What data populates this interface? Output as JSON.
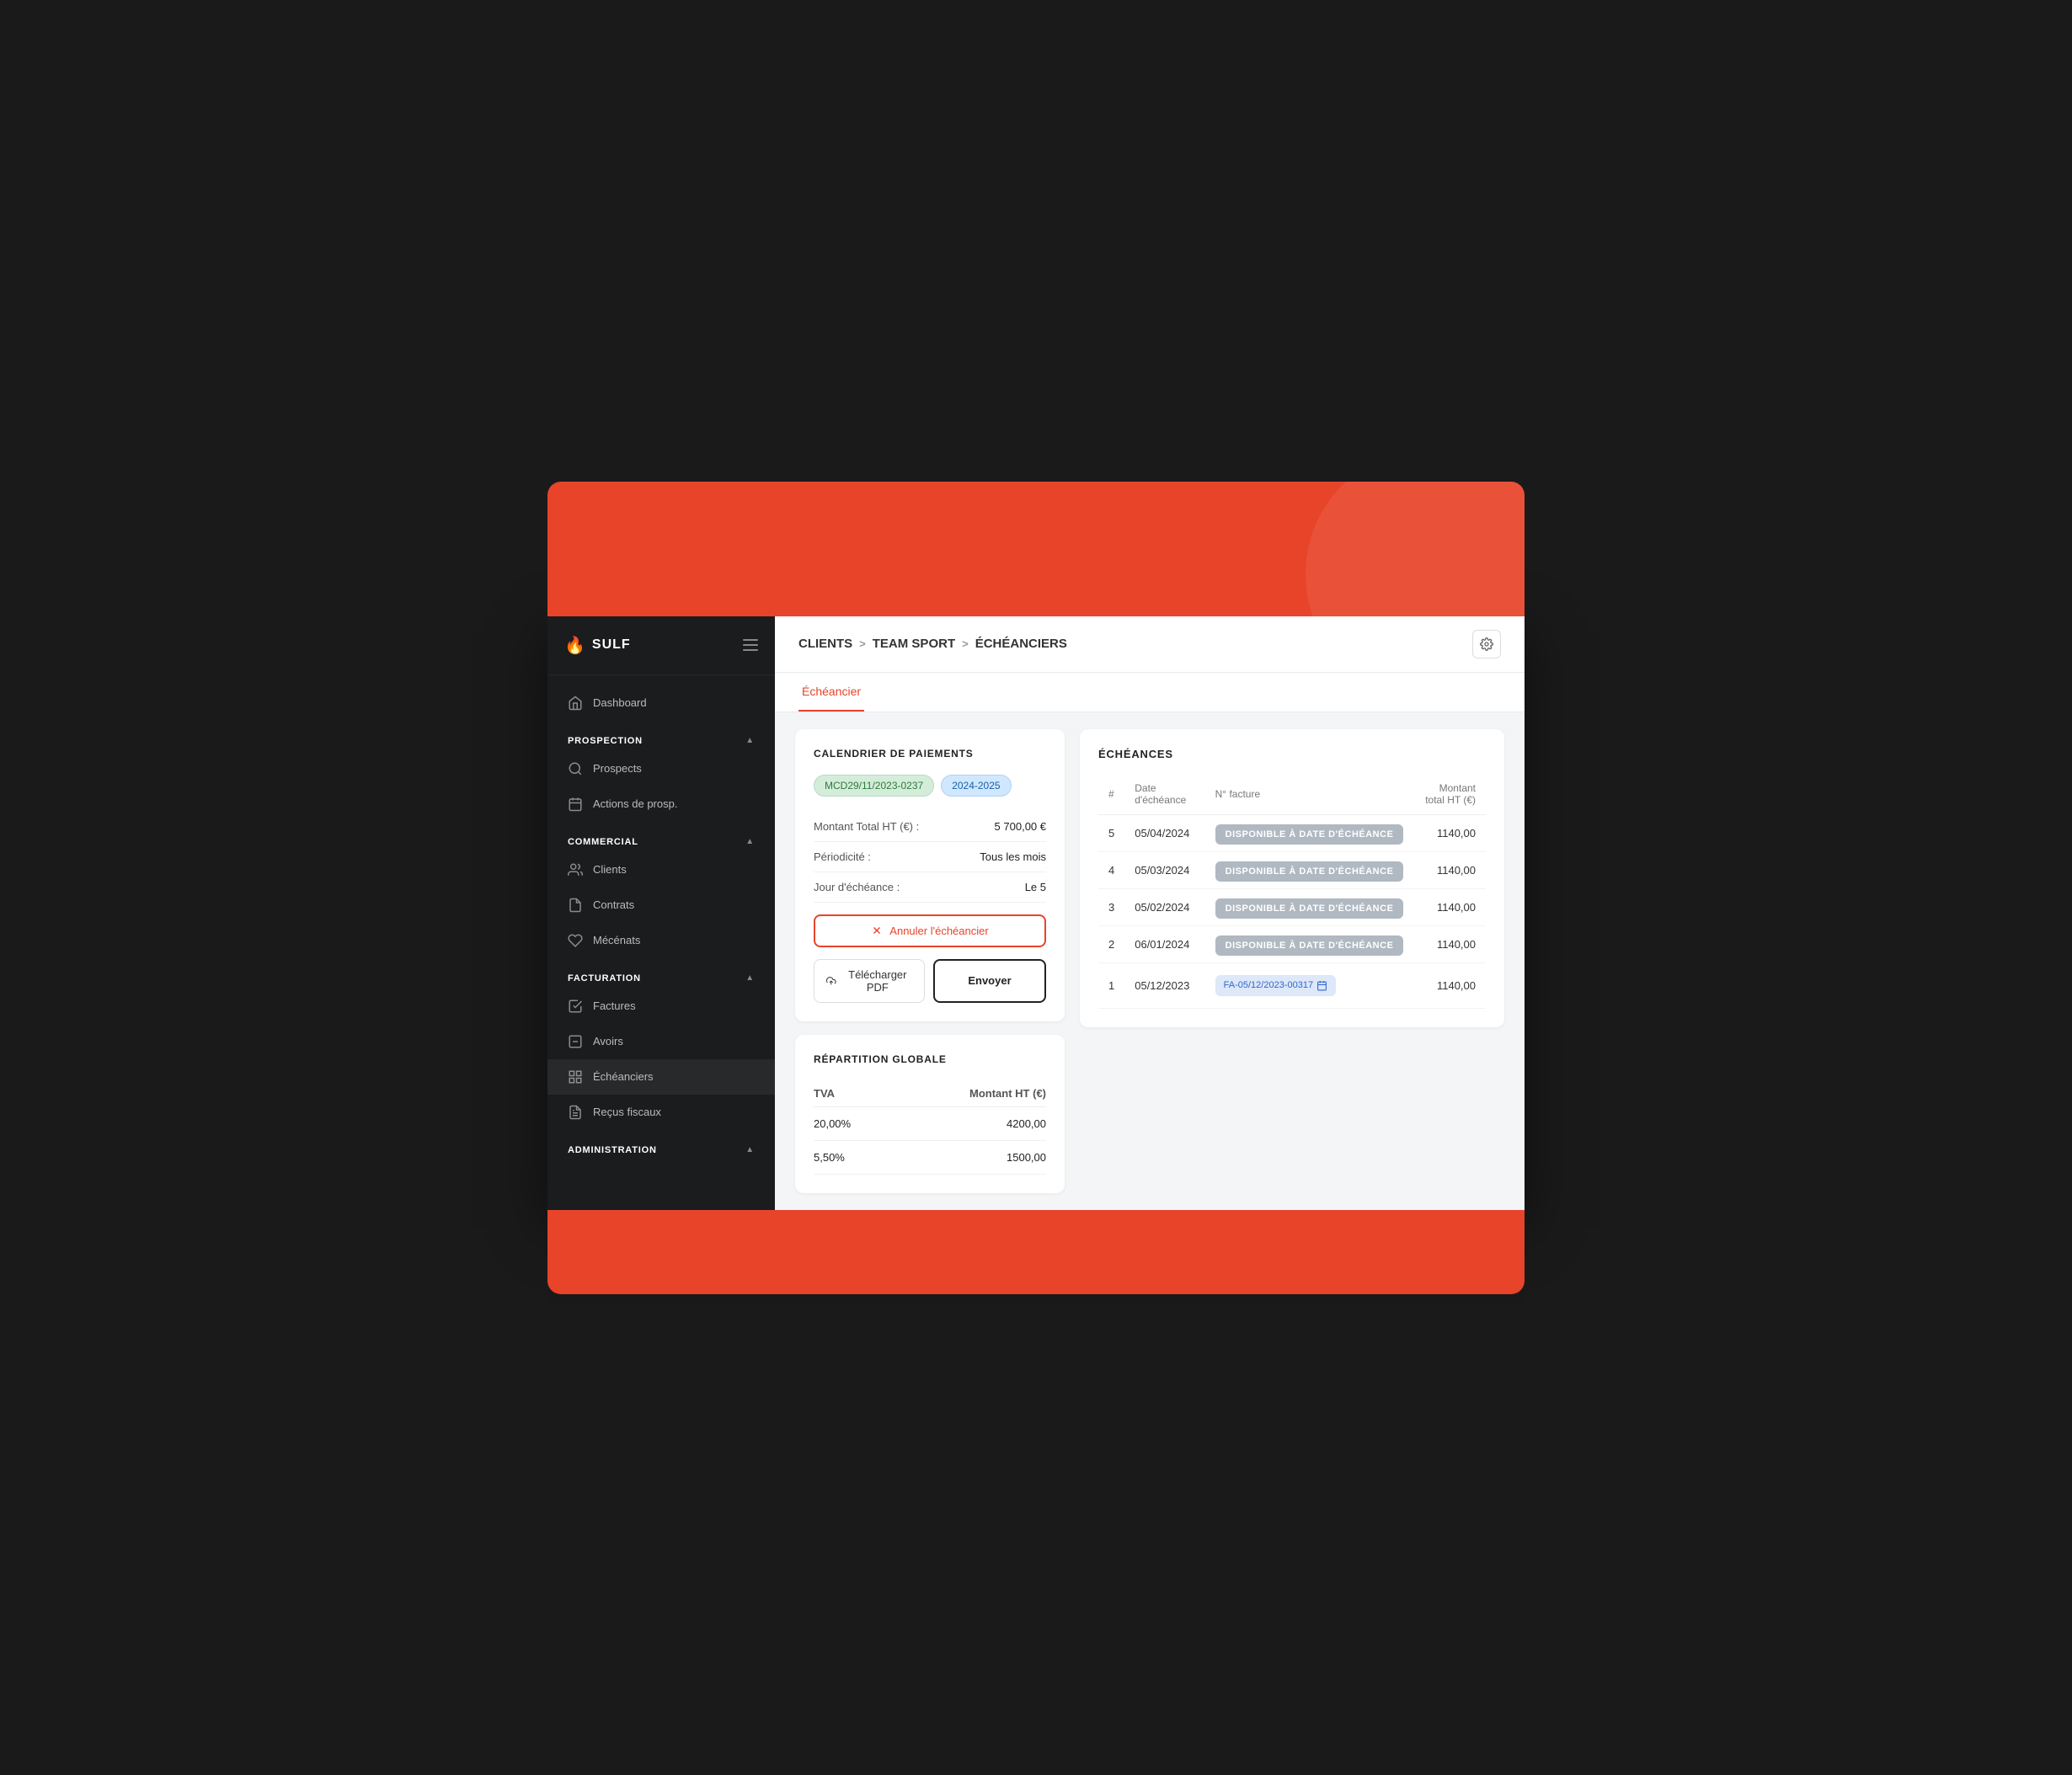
{
  "logo": {
    "text": "SULF",
    "icon": "🔥"
  },
  "sidebar": {
    "dashboard_label": "Dashboard",
    "sections": [
      {
        "id": "prospection",
        "label": "PROSPECTION",
        "items": [
          {
            "id": "prospects",
            "label": "Prospects"
          },
          {
            "id": "actions",
            "label": "Actions de prosp."
          }
        ]
      },
      {
        "id": "commercial",
        "label": "COMMERCIAL",
        "items": [
          {
            "id": "clients",
            "label": "Clients"
          },
          {
            "id": "contrats",
            "label": "Contrats"
          },
          {
            "id": "mecenats",
            "label": "Mécénats"
          }
        ]
      },
      {
        "id": "facturation",
        "label": "FACTURATION",
        "items": [
          {
            "id": "factures",
            "label": "Factures"
          },
          {
            "id": "avoirs",
            "label": "Avoirs"
          },
          {
            "id": "echeanciers",
            "label": "Échéanciers"
          },
          {
            "id": "recus",
            "label": "Reçus fiscaux"
          }
        ]
      },
      {
        "id": "administration",
        "label": "ADMINISTRATION",
        "items": []
      }
    ]
  },
  "breadcrumb": {
    "items": [
      "CLIENTS",
      "TEAM SPORT",
      "ÉCHÉANCIERS"
    ],
    "separators": [
      ">",
      ">"
    ]
  },
  "tabs": [
    {
      "id": "echeancier",
      "label": "Échéancier",
      "active": true
    }
  ],
  "calendrier": {
    "title": "CALENDRIER DE PAIEMENTS",
    "tag1": "MCD29/11/2023-0237",
    "tag2": "2024-2025",
    "montant_label": "Montant Total HT (€) :",
    "montant_value": "5 700,00 €",
    "periodicite_label": "Périodicité :",
    "periodicite_value": "Tous les mois",
    "echeance_label": "Jour d'échéance :",
    "echeance_value": "Le 5",
    "btn_cancel": "Annuler l'échéancier",
    "btn_pdf": "Télécharger PDF",
    "btn_send": "Envoyer"
  },
  "repartition": {
    "title": "RÉPARTITION GLOBALE",
    "col_tva": "TVA",
    "col_montant": "Montant HT (€)",
    "rows": [
      {
        "tva": "20,00%",
        "montant": "4200,00"
      },
      {
        "tva": "5,50%",
        "montant": "1500,00"
      }
    ]
  },
  "echeances": {
    "title": "ÉCHÉANCES",
    "columns": [
      "#",
      "Date d'échéance",
      "N° facture",
      "Montant total HT (€)"
    ],
    "rows": [
      {
        "num": "5",
        "date": "05/04/2024",
        "facture": "DISPONIBLE À DATE D'ÉCHÉANCE",
        "facture_type": "badge",
        "montant": "1140,00"
      },
      {
        "num": "4",
        "date": "05/03/2024",
        "facture": "DISPONIBLE À DATE D'ÉCHÉANCE",
        "facture_type": "badge",
        "montant": "1140,00"
      },
      {
        "num": "3",
        "date": "05/02/2024",
        "facture": "DISPONIBLE À DATE D'ÉCHÉANCE",
        "facture_type": "badge",
        "montant": "1140,00"
      },
      {
        "num": "2",
        "date": "06/01/2024",
        "facture": "DISPONIBLE À DATE D'ÉCHÉANCE",
        "facture_type": "badge",
        "montant": "1140,00"
      },
      {
        "num": "1",
        "date": "05/12/2023",
        "facture": "FA-05/12/2023-00317",
        "facture_type": "invoice",
        "montant": "1140,00"
      }
    ]
  }
}
